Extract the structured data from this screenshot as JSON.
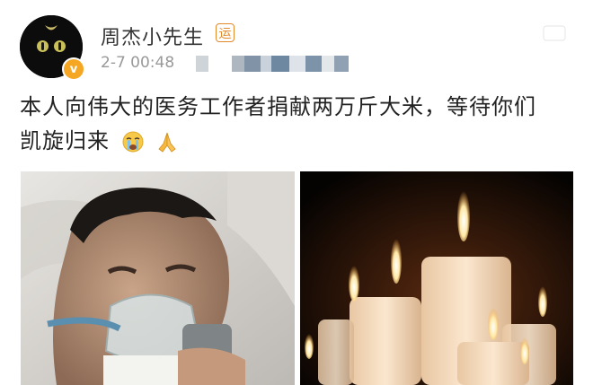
{
  "user": {
    "name": "周杰小先生",
    "tag_label": "运",
    "verified_mark": "v",
    "time": "2-7 00:48"
  },
  "post": {
    "line1": "本人向伟大的医务工作者捐献两万斤大米，等待你们",
    "line2": "凯旋归来"
  },
  "icons": [
    "verified-badge-icon",
    "crying-face-icon",
    "praying-hands-icon",
    "more-menu-icon"
  ],
  "colors": {
    "verified": "#f5a623",
    "tag": "#e58a2a",
    "text": "#222222",
    "meta": "#999999"
  }
}
